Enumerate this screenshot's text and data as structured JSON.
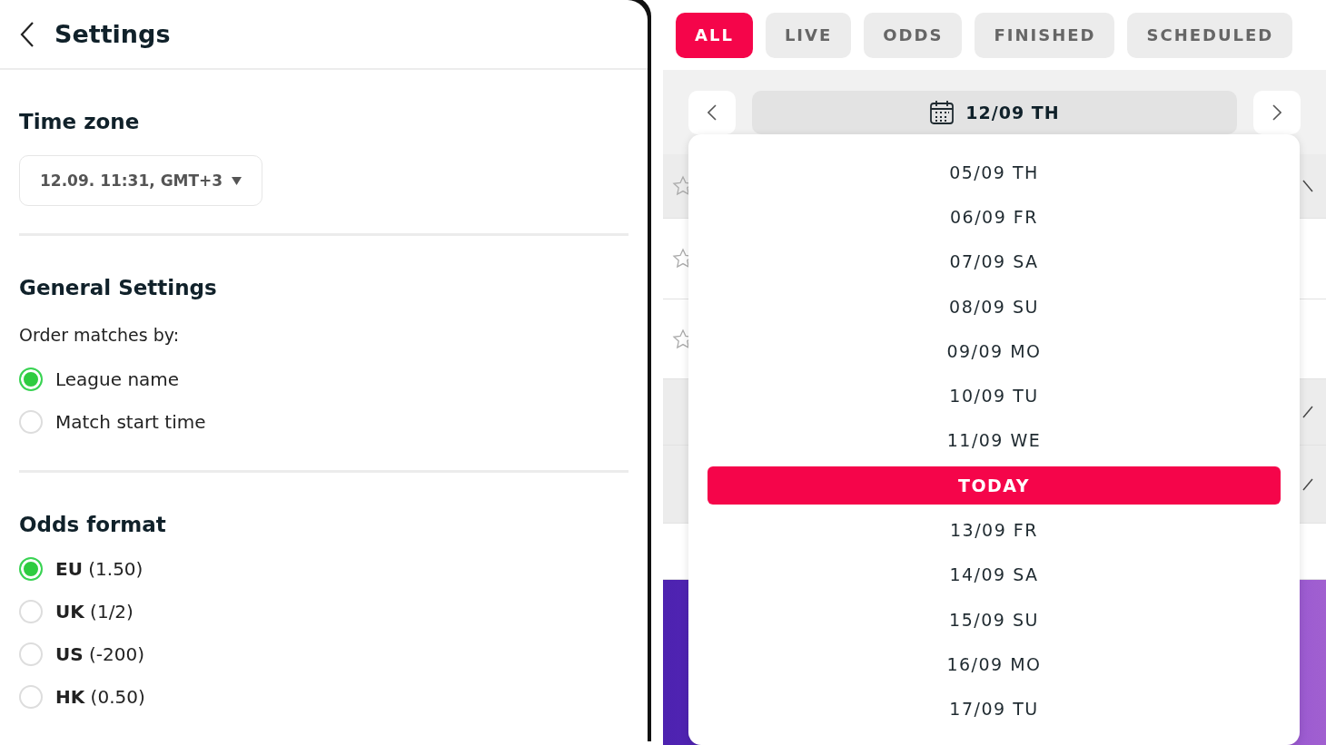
{
  "settings": {
    "title": "Settings",
    "time_zone": {
      "heading": "Time zone",
      "value": "12.09. 11:31, GMT+3"
    },
    "general": {
      "heading": "General Settings",
      "label": "Order matches by:",
      "options": [
        {
          "label": "League name",
          "selected": true
        },
        {
          "label": "Match start time",
          "selected": false
        }
      ]
    },
    "odds": {
      "heading": "Odds format",
      "options": [
        {
          "label": "**EU** (1.50)",
          "selected": true
        },
        {
          "label": "**UK** (1/2)",
          "selected": false
        },
        {
          "label": "**US** (-200)",
          "selected": false
        },
        {
          "label": "**HK** (0.50)",
          "selected": false
        }
      ]
    }
  },
  "filter_tabs": [
    {
      "label": "ALL",
      "selected": true
    },
    {
      "label": "LIVE",
      "selected": false
    },
    {
      "label": "ODDS",
      "selected": false
    },
    {
      "label": "FINISHED",
      "selected": false
    },
    {
      "label": "SCHEDULED",
      "selected": false
    }
  ],
  "date_picker": {
    "current": "12/09 TH",
    "options": [
      {
        "label": "05/09 TH",
        "selected": false
      },
      {
        "label": "06/09 FR",
        "selected": false
      },
      {
        "label": "07/09 SA",
        "selected": false
      },
      {
        "label": "08/09 SU",
        "selected": false
      },
      {
        "label": "09/09 MO",
        "selected": false
      },
      {
        "label": "10/09 TU",
        "selected": false
      },
      {
        "label": "11/09 WE",
        "selected": false
      },
      {
        "label": "TODAY",
        "selected": true
      },
      {
        "label": "13/09 FR",
        "selected": false
      },
      {
        "label": "14/09 SA",
        "selected": false
      },
      {
        "label": "15/09 SU",
        "selected": false
      },
      {
        "label": "16/09 MO",
        "selected": false
      },
      {
        "label": "17/09 TU",
        "selected": false
      }
    ]
  }
}
